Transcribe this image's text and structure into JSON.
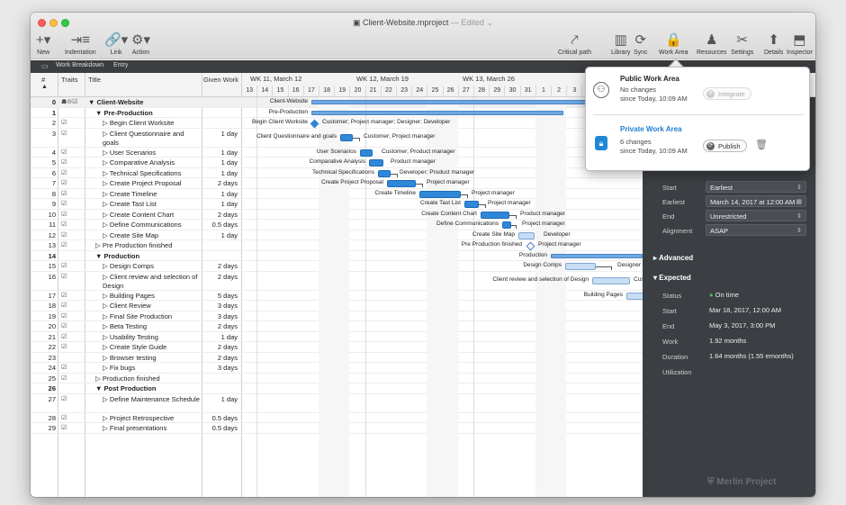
{
  "window": {
    "title": "Client-Website.mproject",
    "edited": " — Edited ⌄"
  },
  "toolbar": {
    "left": [
      {
        "icon": "plus-icon",
        "glyph": "+▾",
        "label": "New"
      },
      {
        "icon": "indentation-icon",
        "glyph": "⇥≡",
        "label": "Indentation"
      },
      {
        "icon": "link-icon",
        "glyph": "🔗▾",
        "label": "Link"
      },
      {
        "icon": "gear-icon",
        "glyph": "⚙▾",
        "label": "Action"
      }
    ],
    "right": [
      {
        "icon": "critical-path-icon",
        "glyph": "⤤",
        "label": "Critical path"
      },
      {
        "icon": "library-icon",
        "glyph": "▥",
        "label": "Library"
      },
      {
        "icon": "sync-icon",
        "glyph": "⟳",
        "label": "Sync"
      },
      {
        "icon": "lock-icon",
        "glyph": "🔒",
        "label": "Work Area"
      },
      {
        "icon": "resources-icon",
        "glyph": "♟",
        "label": "Resources"
      },
      {
        "icon": "settings-icon",
        "glyph": "✂",
        "label": "Settings"
      },
      {
        "icon": "details-icon",
        "glyph": "⬆",
        "label": "Details"
      },
      {
        "icon": "inspector-icon",
        "glyph": "⬒",
        "label": "Inspector"
      }
    ]
  },
  "subbar": {
    "view": "Work Breakdown",
    "entry": "Entry"
  },
  "columns": {
    "num": "#",
    "traits": "Traits",
    "title": "Title",
    "work": "Given Work"
  },
  "weeks": [
    "WK 11, March 12",
    "WK 12, March 19",
    "WK 13, March 26",
    "WI"
  ],
  "days": [
    "13",
    "14",
    "15",
    "16",
    "17",
    "18",
    "19",
    "20",
    "21",
    "22",
    "23",
    "24",
    "25",
    "26",
    "27",
    "28",
    "29",
    "30",
    "31",
    "1",
    "2",
    "3",
    "4"
  ],
  "rows": [
    {
      "num": "0",
      "trait": "☗⊝☑",
      "title": "▼ Client-Website",
      "work": "",
      "indent": 0,
      "bold": true
    },
    {
      "num": "1",
      "trait": "",
      "title": "▼ Pre-Production",
      "work": "",
      "indent": 1,
      "bold": true
    },
    {
      "num": "2",
      "trait": "☑",
      "title": "▷ Begin Client Worksite",
      "work": "",
      "indent": 2
    },
    {
      "num": "3",
      "trait": "☑",
      "title": "▷ Client Questionnaire and goals",
      "work": "1 day",
      "indent": 2,
      "tall": true
    },
    {
      "num": "4",
      "trait": "☑",
      "title": "▷ User Scenarios",
      "work": "1 day",
      "indent": 2
    },
    {
      "num": "5",
      "trait": "☑",
      "title": "▷ Comparative Analysis",
      "work": "1 day",
      "indent": 2
    },
    {
      "num": "6",
      "trait": "☑",
      "title": "▷ Technical Specifications",
      "work": "1 day",
      "indent": 2
    },
    {
      "num": "7",
      "trait": "☑",
      "title": "▷ Create Project Proposal",
      "work": "2 days",
      "indent": 2
    },
    {
      "num": "8",
      "trait": "☑",
      "title": "▷ Create Timeline",
      "work": "1 day",
      "indent": 2
    },
    {
      "num": "9",
      "trait": "☑",
      "title": "▷ Create Tast List",
      "work": "1 day",
      "indent": 2
    },
    {
      "num": "10",
      "trait": "☑",
      "title": "▷ Create Content Chart",
      "work": "2 days",
      "indent": 2
    },
    {
      "num": "11",
      "trait": "☑",
      "title": "▷ Define Communications",
      "work": "0.5 days",
      "indent": 2
    },
    {
      "num": "12",
      "trait": "☑",
      "title": "▷ Create Site Map",
      "work": "1 day",
      "indent": 2
    },
    {
      "num": "13",
      "trait": "☑",
      "title": "▷ Pre Production finished",
      "work": "",
      "indent": 1
    },
    {
      "num": "14",
      "trait": "",
      "title": "▼ Production",
      "work": "",
      "indent": 1,
      "bold": true
    },
    {
      "num": "15",
      "trait": "☑",
      "title": "▷ Design Comps",
      "work": "2 days",
      "indent": 2
    },
    {
      "num": "16",
      "trait": "☑",
      "title": "▷ Client review and selection of Design",
      "work": "2 days",
      "indent": 2,
      "tall": true
    },
    {
      "num": "17",
      "trait": "☑",
      "title": "▷ Building Pages",
      "work": "5 days",
      "indent": 2
    },
    {
      "num": "18",
      "trait": "☑",
      "title": "▷ Client Review",
      "work": "3 days",
      "indent": 2
    },
    {
      "num": "19",
      "trait": "☑",
      "title": "▷ Final Site Production",
      "work": "3 days",
      "indent": 2
    },
    {
      "num": "20",
      "trait": "☑",
      "title": "▷ Beta Testing",
      "work": "2 days",
      "indent": 2
    },
    {
      "num": "21",
      "trait": "☑",
      "title": "▷ Usability Testing",
      "work": "1 day",
      "indent": 2
    },
    {
      "num": "22",
      "trait": "☑",
      "title": "▷ Create Style Guide",
      "work": "2 days",
      "indent": 2
    },
    {
      "num": "23",
      "trait": "",
      "title": "▷ Browser testing",
      "work": "2 days",
      "indent": 2
    },
    {
      "num": "24",
      "trait": "☑",
      "title": "▷ Fix bugs",
      "work": "3 days",
      "indent": 2
    },
    {
      "num": "25",
      "trait": "☑",
      "title": "▷ Production finished",
      "work": "",
      "indent": 1
    },
    {
      "num": "26",
      "trait": "",
      "title": "▼ Post Production",
      "work": "",
      "indent": 1,
      "bold": true
    },
    {
      "num": "27",
      "trait": "☑",
      "title": "▷ Define Maintenance Schedule",
      "work": "1 day",
      "indent": 2,
      "tall": true
    },
    {
      "num": "28",
      "trait": "☑",
      "title": "▷ Project Retrospective",
      "work": "0.5 days",
      "indent": 2
    },
    {
      "num": "29",
      "trait": "☑",
      "title": "▷ Final presentations",
      "work": "0.5 days",
      "indent": 2
    }
  ],
  "gantt": {
    "labels": {
      "client_website": "Client-Website",
      "pre_production": "Pre-Production",
      "begin_client": "Begin Client Worksite",
      "begin_client_res": "Customer; Project manager; Designer; Developer",
      "questionnaire": "Client Questionnaire and goals",
      "questionnaire_res": "Customer; Project manager",
      "scenarios": "User Scenarios",
      "scenarios_res": "Customer; Product manager",
      "comparative": "Comparative Analysis",
      "comparative_res": "Product manager",
      "techspec": "Technical Specifications",
      "techspec_res": "Developer; Product manager",
      "proposal": "Create Project Proposal",
      "proposal_res": "Project manager",
      "timeline": "Create Timeline",
      "timeline_res": "Project manager",
      "tasklist": "Create Tast List",
      "tasklist_res": "Project manager",
      "content": "Create Content Chart",
      "content_res": "Product manager",
      "comms": "Define Communications",
      "comms_res": "Project manager",
      "sitemap": "Create Site Map",
      "sitemap_res": "Developer",
      "prefinished": "Pre Production finished",
      "prefinished_res": "Project manager",
      "production": "Production",
      "designcomps": "Design Comps",
      "designcomps_res": "Designer",
      "clientreview": "Client review and selection of Design",
      "clientreview_res": "Cus",
      "building": "Building Pages"
    }
  },
  "popover": {
    "public_title": "Public Work Area",
    "public_status": "No changes",
    "public_since": "since Today, 10:09 AM",
    "integrate": "Integrate",
    "private_title": "Private Work Area",
    "private_status": "6 changes",
    "private_since": "since Today, 10:09 AM",
    "publish": "Publish"
  },
  "inspector": {
    "fields": [
      {
        "key": "Start",
        "value": "Earliest",
        "kind": "select"
      },
      {
        "key": "Earliest",
        "value": "March 14, 2017 at 12:00 AM",
        "kind": "date"
      },
      {
        "key": "End",
        "value": "Unrestricted",
        "kind": "select"
      },
      {
        "key": "Alignment",
        "value": "ASAP",
        "kind": "select"
      }
    ],
    "advanced": "Advanced",
    "expected": "Expected",
    "expected_fields": [
      {
        "key": "Status",
        "value": "On time"
      },
      {
        "key": "Start",
        "value": "Mar 18, 2017, 12:00 AM"
      },
      {
        "key": "End",
        "value": "May 3, 2017, 3:00 PM"
      },
      {
        "key": "Work",
        "value": "1.92 months"
      },
      {
        "key": "Duration",
        "value": "1.64 months (1.55 emonths)"
      },
      {
        "key": "Utilization",
        "value": ""
      }
    ],
    "status_color": "#3dc95a",
    "logo": "Merlin Project"
  }
}
